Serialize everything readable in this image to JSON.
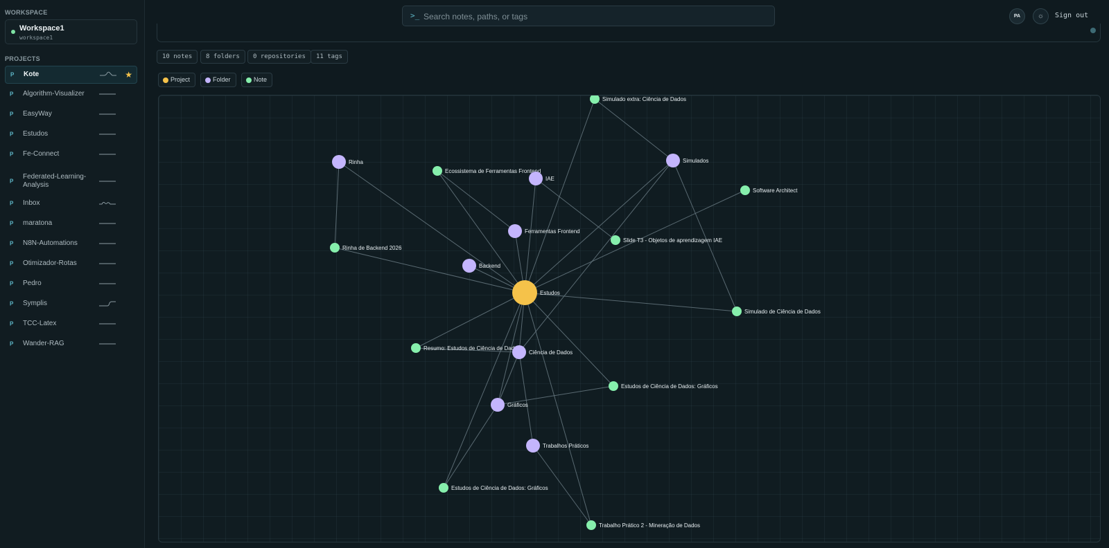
{
  "sidebar": {
    "workspace_label": "WORKSPACE",
    "workspace": {
      "name": "Workspace1",
      "id": "workspace1"
    },
    "projects_label": "PROJECTS",
    "projects": [
      {
        "prefix": "P",
        "name": "Kote",
        "active": true,
        "starred": true,
        "trend": "spike"
      },
      {
        "prefix": "P",
        "name": "Algorithm-Visualizer",
        "trend": "flat"
      },
      {
        "prefix": "P",
        "name": "EasyWay",
        "trend": "flat"
      },
      {
        "prefix": "P",
        "name": "Estudos",
        "trend": "flat"
      },
      {
        "prefix": "P",
        "name": "Fe-Connect",
        "trend": "flat"
      },
      {
        "prefix": "P",
        "name": "Federated-Learning-Analysis",
        "trend": "flat"
      },
      {
        "prefix": "P",
        "name": "Inbox",
        "trend": "wave"
      },
      {
        "prefix": "P",
        "name": "maratona",
        "trend": "flat"
      },
      {
        "prefix": "P",
        "name": "N8N-Automations",
        "trend": "flat"
      },
      {
        "prefix": "P",
        "name": "Otimizador-Rotas",
        "trend": "flat"
      },
      {
        "prefix": "P",
        "name": "Pedro",
        "trend": "flat"
      },
      {
        "prefix": "P",
        "name": "Symplis",
        "trend": "step"
      },
      {
        "prefix": "P",
        "name": "TCC-Latex",
        "trend": "flat"
      },
      {
        "prefix": "P",
        "name": "Wander-RAG",
        "trend": "flat"
      }
    ]
  },
  "header": {
    "search_icon": ">_",
    "search_placeholder": "Search notes, paths, or tags",
    "avatar": "PA",
    "theme_icon": "sun-icon",
    "sign_out": "Sign out"
  },
  "stats": [
    "10 notes",
    "8 folders",
    "0 repositories",
    "11 tags"
  ],
  "legend": [
    {
      "label": "Project",
      "color": "#f5c24a"
    },
    {
      "label": "Folder",
      "color": "#c4b5fd"
    },
    {
      "label": "Note",
      "color": "#86efac"
    }
  ],
  "colors": {
    "project": "#f5c24a",
    "folder": "#c4b5fd",
    "note": "#86efac",
    "edge": "#6b7d86"
  },
  "graph": {
    "nodes": [
      {
        "id": "estudos",
        "label": "Estudos",
        "type": "project"
      },
      {
        "id": "sim_extra",
        "label": "Simulado extra: Ciência de Dados",
        "type": "note"
      },
      {
        "id": "simulados",
        "label": "Simulados",
        "type": "folder"
      },
      {
        "id": "rinha",
        "label": "Rinha",
        "type": "folder"
      },
      {
        "id": "eco",
        "label": "Ecossistema de Ferramentas Frontend",
        "type": "note"
      },
      {
        "id": "iae",
        "label": "IAE",
        "type": "folder"
      },
      {
        "id": "software",
        "label": "Software Architect",
        "type": "note"
      },
      {
        "id": "ferr",
        "label": "Ferramentas Frontend",
        "type": "folder"
      },
      {
        "id": "slide",
        "label": "Slide T3 - Objetos de aprendizagem IAE",
        "type": "note"
      },
      {
        "id": "rinha26",
        "label": "Rinha de Backend 2026",
        "type": "note"
      },
      {
        "id": "backend",
        "label": "Backend",
        "type": "folder"
      },
      {
        "id": "simcd",
        "label": "Simulado de Ciência de Dados",
        "type": "note"
      },
      {
        "id": "resumo",
        "label": "Resumo: Estudos de Ciência de Dados",
        "type": "note"
      },
      {
        "id": "ciencia",
        "label": "Ciência de Dados",
        "type": "folder"
      },
      {
        "id": "graf_note",
        "label": "Estudos de Ciência de Dados: Gráficos",
        "type": "note"
      },
      {
        "id": "graficos",
        "label": "Gráficos",
        "type": "folder"
      },
      {
        "id": "trab",
        "label": "Trabalhos Práticos",
        "type": "folder"
      },
      {
        "id": "graf_note2",
        "label": "Estudos de Ciência de Dados: Gráficos",
        "type": "note"
      },
      {
        "id": "tp2",
        "label": "Trabalho Prático 2 - Mineração de Dados",
        "type": "note"
      }
    ],
    "edges": [
      [
        "estudos",
        "sim_extra"
      ],
      [
        "estudos",
        "simulados"
      ],
      [
        "estudos",
        "rinha"
      ],
      [
        "estudos",
        "eco"
      ],
      [
        "estudos",
        "iae"
      ],
      [
        "estudos",
        "software"
      ],
      [
        "estudos",
        "ferr"
      ],
      [
        "estudos",
        "rinha26"
      ],
      [
        "estudos",
        "backend"
      ],
      [
        "estudos",
        "simcd"
      ],
      [
        "estudos",
        "resumo"
      ],
      [
        "estudos",
        "ciencia"
      ],
      [
        "estudos",
        "graf_note"
      ],
      [
        "estudos",
        "graficos"
      ],
      [
        "estudos",
        "tp2"
      ],
      [
        "estudos",
        "graf_note2"
      ],
      [
        "sim_extra",
        "simulados"
      ],
      [
        "simulados",
        "simcd"
      ],
      [
        "simulados",
        "ciencia"
      ],
      [
        "rinha",
        "rinha26"
      ],
      [
        "eco",
        "ferr"
      ],
      [
        "iae",
        "slide"
      ],
      [
        "ciencia",
        "resumo"
      ],
      [
        "ciencia",
        "trab"
      ],
      [
        "ciencia",
        "graficos"
      ],
      [
        "graficos",
        "graf_note"
      ],
      [
        "graficos",
        "graf_note2"
      ],
      [
        "trab",
        "tp2"
      ]
    ]
  }
}
